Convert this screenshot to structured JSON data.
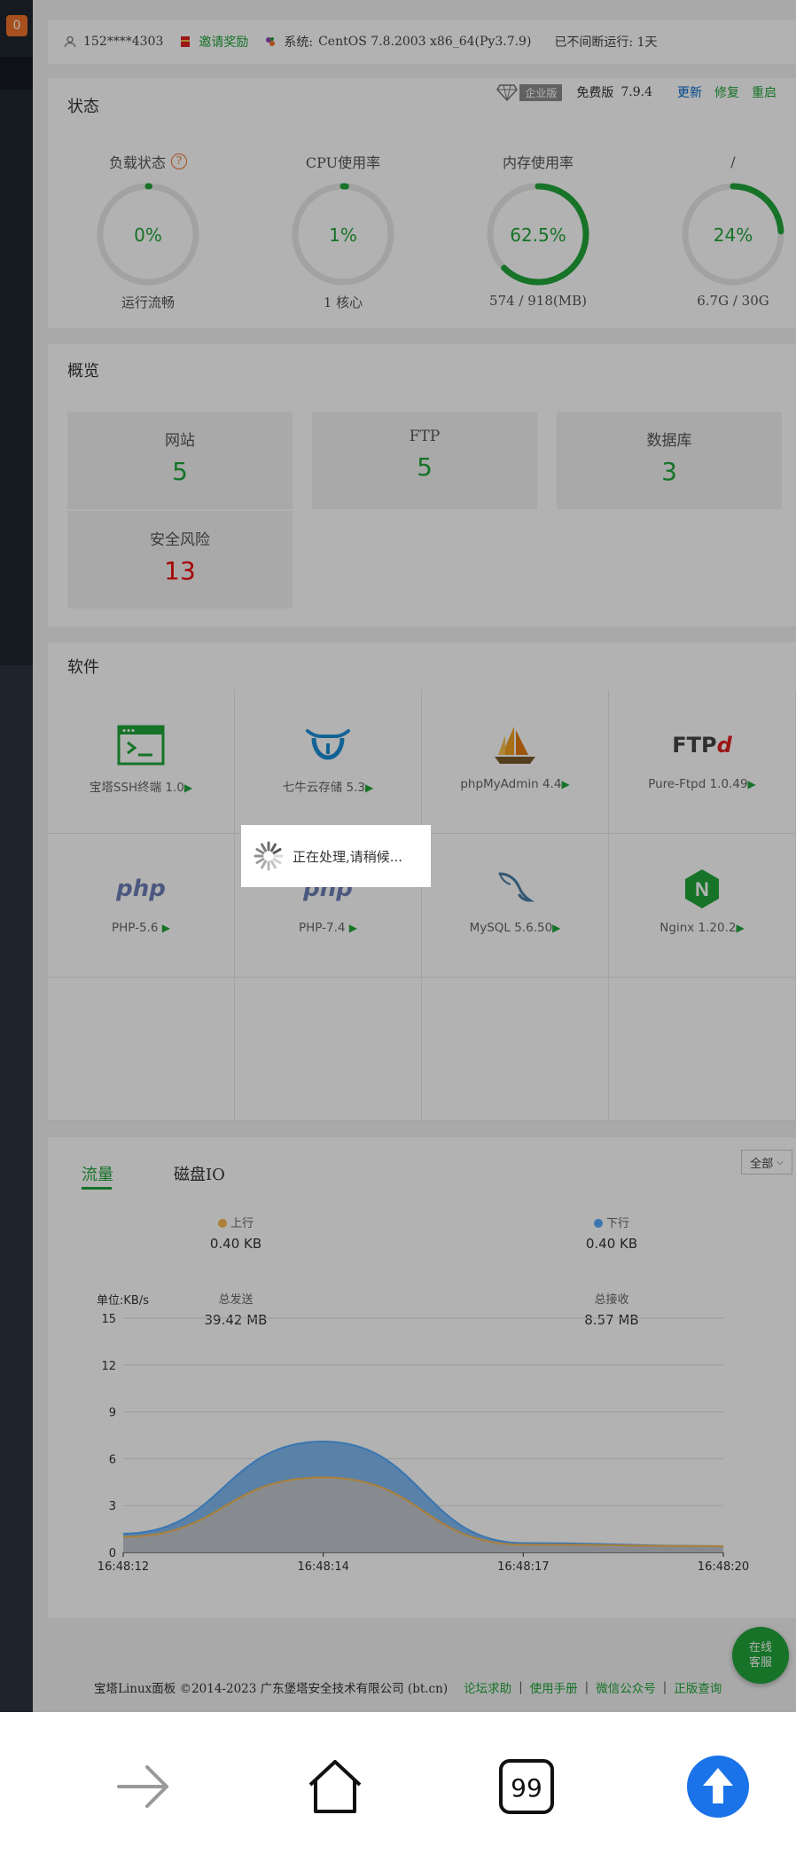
{
  "sidebar": {
    "badge": "0"
  },
  "infobar": {
    "phone": "152****4303",
    "invite": "邀请奖励",
    "system_label": "系统:",
    "system_value": "CentOS 7.8.2003 x86_64(Py3.7.9)",
    "uptime": "已不间断运行: 1天"
  },
  "status": {
    "title": "状态",
    "enterprise_label": "企业版",
    "free_label": "免费版",
    "version": "7.9.4",
    "update": "更新",
    "repair": "修复",
    "restart": "重启",
    "gauges": [
      {
        "title": "负载状态",
        "value": "0%",
        "fraction": 0.0,
        "sub": "运行流畅"
      },
      {
        "title": "CPU使用率",
        "value": "1%",
        "fraction": 0.01,
        "sub": "1 核心"
      },
      {
        "title": "内存使用率",
        "value": "62.5%",
        "fraction": 0.625,
        "sub": "574 / 918(MB)"
      },
      {
        "title": "/",
        "value": "24%",
        "fraction": 0.24,
        "sub": "6.7G / 30G"
      }
    ],
    "help_mark": "?"
  },
  "overview": {
    "title": "概览",
    "items": [
      {
        "label": "网站",
        "value": "5"
      },
      {
        "label": "FTP",
        "value": "5"
      },
      {
        "label": "数据库",
        "value": "3"
      },
      {
        "label": "安全风险",
        "value": "13"
      }
    ]
  },
  "software": {
    "title": "软件",
    "items": [
      {
        "label": "宝塔SSH终端 1.0",
        "icon": "terminal-icon"
      },
      {
        "label": "七牛云存储 5.3",
        "icon": "qiniu-icon"
      },
      {
        "label": "phpMyAdmin 4.4",
        "icon": "phpmyadmin-icon"
      },
      {
        "label": "Pure-Ftpd 1.0.49",
        "icon": "ftpd-icon"
      },
      {
        "label": "PHP-5.6 ",
        "icon": "php-icon"
      },
      {
        "label": "PHP-7.4 ",
        "icon": "php-icon"
      },
      {
        "label": "MySQL 5.6.50",
        "icon": "mysql-icon"
      },
      {
        "label": "Nginx 1.20.2",
        "icon": "nginx-icon"
      }
    ],
    "ftp_logo": "FTP",
    "php_logo": "php",
    "nginx_logo": "N",
    "arrow": "▶"
  },
  "traffic": {
    "tabs": [
      "流量",
      "磁盘IO"
    ],
    "select": "全部",
    "up_label": "上行",
    "up_value": "0.40 KB",
    "down_label": "下行",
    "down_value": "0.40 KB",
    "total_sent_label": "总发送",
    "total_sent": "39.42 MB",
    "total_recv_label": "总接收",
    "total_recv": "8.57 MB",
    "unit": "单位:KB/s",
    "colors": {
      "up": "#f7b851",
      "down": "#52a9ff"
    }
  },
  "chart_data": {
    "type": "area",
    "x": [
      "16:48:12",
      "16:48:14",
      "16:48:17",
      "16:48:20"
    ],
    "ylim": [
      0,
      15
    ],
    "yticks": [
      0,
      3,
      6,
      9,
      12,
      15
    ],
    "ylabel": "单位:KB/s",
    "series": [
      {
        "name": "上行",
        "color": "#f7b851",
        "values": [
          1.0,
          4.8,
          0.5,
          0.4
        ]
      },
      {
        "name": "下行",
        "color": "#52a9ff",
        "values": [
          1.2,
          7.1,
          0.6,
          0.4
        ]
      }
    ]
  },
  "footer": {
    "copyright": "宝塔Linux面板 ©2014-2023 广东堡塔安全技术有限公司 (bt.cn)",
    "links": [
      "论坛求助",
      "使用手册",
      "微信公众号",
      "正版查询"
    ],
    "sep": "|"
  },
  "chat": {
    "line1": "在线",
    "line2": "客服"
  },
  "loading": {
    "text": "正在处理,请稍候..."
  },
  "browser": {
    "tabs_count": "99"
  }
}
